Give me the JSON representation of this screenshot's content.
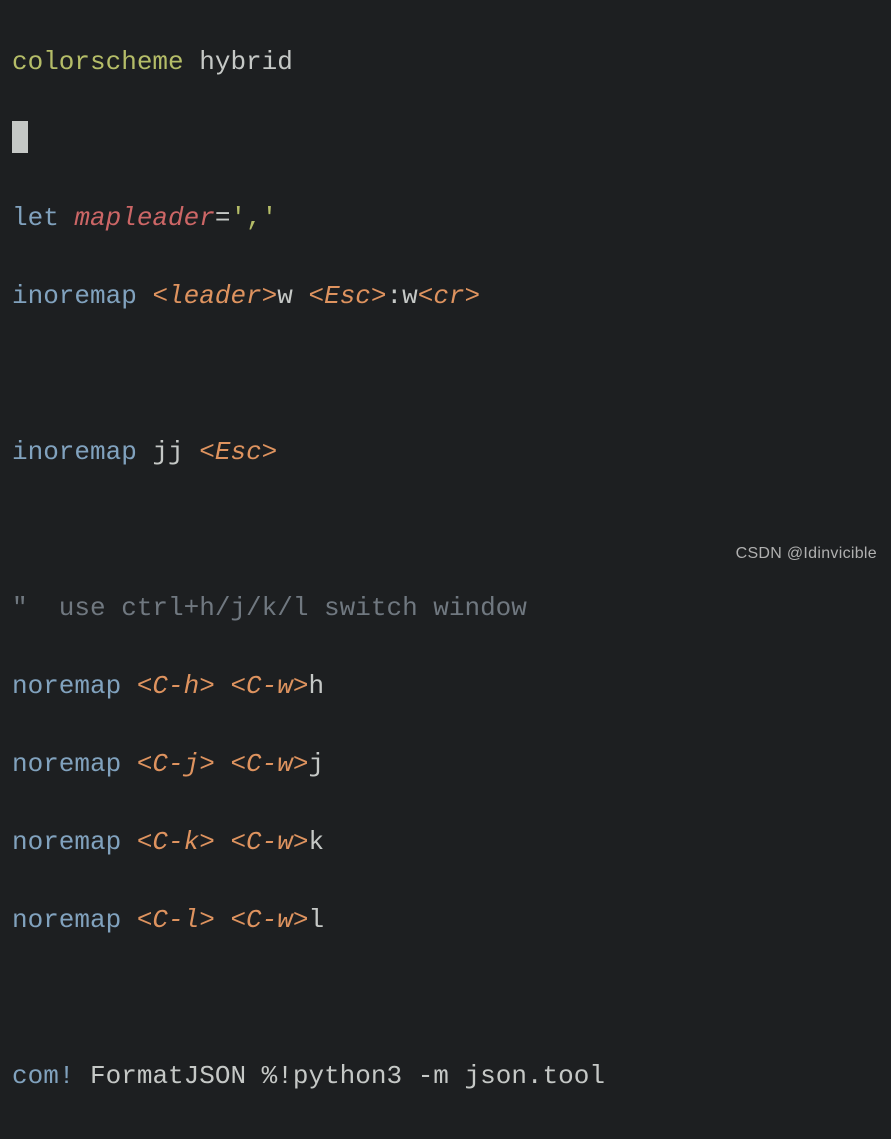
{
  "lines": {
    "l1": {
      "kw": "colorscheme",
      "arg": "hybrid"
    },
    "l3": {
      "kw": "let",
      "var": "mapleader",
      "op": "=",
      "val": "','"
    },
    "l4": {
      "kw": "inoremap",
      "lhs1": "<leader>",
      "lhs2": "w",
      "rhs1": "<Esc>",
      "rhs2": ":w",
      "rhs3": "<cr>"
    },
    "l6": {
      "kw": "inoremap",
      "lhs": "jj",
      "rhs": "<Esc>"
    },
    "l8": {
      "text": "\"  use ctrl+h/j/k/l switch window"
    },
    "l9": {
      "kw": "noremap",
      "lhs": "<C-h>",
      "rhs1": "<C-w>",
      "rhs2": "h"
    },
    "l10": {
      "kw": "noremap",
      "lhs": "<C-j>",
      "rhs1": "<C-w>",
      "rhs2": "j"
    },
    "l11": {
      "kw": "noremap",
      "lhs": "<C-k>",
      "rhs1": "<C-w>",
      "rhs2": "k"
    },
    "l12": {
      "kw": "noremap",
      "lhs": "<C-l>",
      "rhs1": "<C-w>",
      "rhs2": "l"
    },
    "l14": {
      "kw": "com!",
      "name": "FormatJSON",
      "cmd": "%!python3 -m json.tool"
    }
  },
  "watermark": "CSDN @Idinvicible"
}
